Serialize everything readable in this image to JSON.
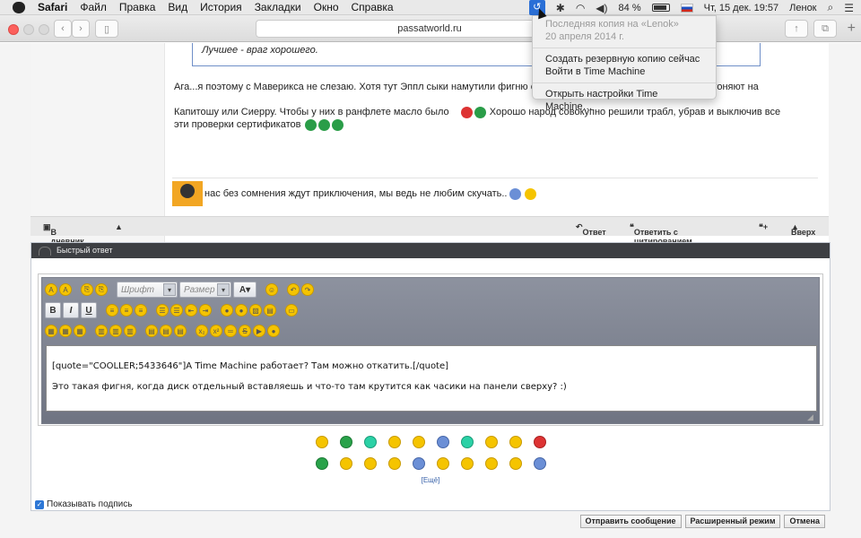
{
  "menubar": {
    "app": "Safari",
    "items": [
      "Файл",
      "Правка",
      "Вид",
      "История",
      "Закладки",
      "Окно",
      "Справка"
    ],
    "battery": "84 %",
    "datetime": "Чт, 15 дек. 19:57",
    "user": "Ленок"
  },
  "toolbar": {
    "url": "passatworld.ru"
  },
  "time_machine_menu": {
    "last_backup_label": "Последняя копия на «Lenok»",
    "last_backup_date": "20 апреля 2014 г.",
    "backup_now": "Создать резервную копию сейчас",
    "enter_tm": "Войти в Time Machine",
    "open_prefs": "Открыть настройки Time Machine…"
  },
  "post": {
    "quote_text": "Лучшее - враг хорошего.",
    "line1": "Ага...я поэтому с Маверикса не слезаю. Хотя тут Эппл сыки намутили фигню с",
    "line1_tail": "Выгоняют на",
    "line2": "Капитошу или Сиерру. Чтобы у них в ранфлете масло было",
    "line2_tail": "Хорошо народ совокупно решили трабл, убрав и выключив все",
    "line3": "эти проверки сертификатов",
    "signature": "нас без сомнения ждут приключения, мы ведь не любим скучать.."
  },
  "actions": {
    "diary": "В дневник",
    "reply": "Ответ",
    "reply_quote": "Ответить с цитированием",
    "top": "Вверх"
  },
  "quick_reply": {
    "title": "Быстрый ответ",
    "font_placeholder": "Шрифт",
    "size_placeholder": "Размер",
    "text_line1": "[quote=\"COOLLER;5433646\"]А Time Machine работает? Там можно откатить.[/quote]",
    "text_line2": "Это такая фигня, когда диск отдельный вставляешь и что-то там крутится как часики на панели сверху? :)",
    "more_smileys": "[Ещё]",
    "show_signature": "Показывать подпись"
  },
  "buttons": {
    "submit": "Отправить сообщение",
    "advanced": "Расширенный режим",
    "cancel": "Отмена"
  }
}
